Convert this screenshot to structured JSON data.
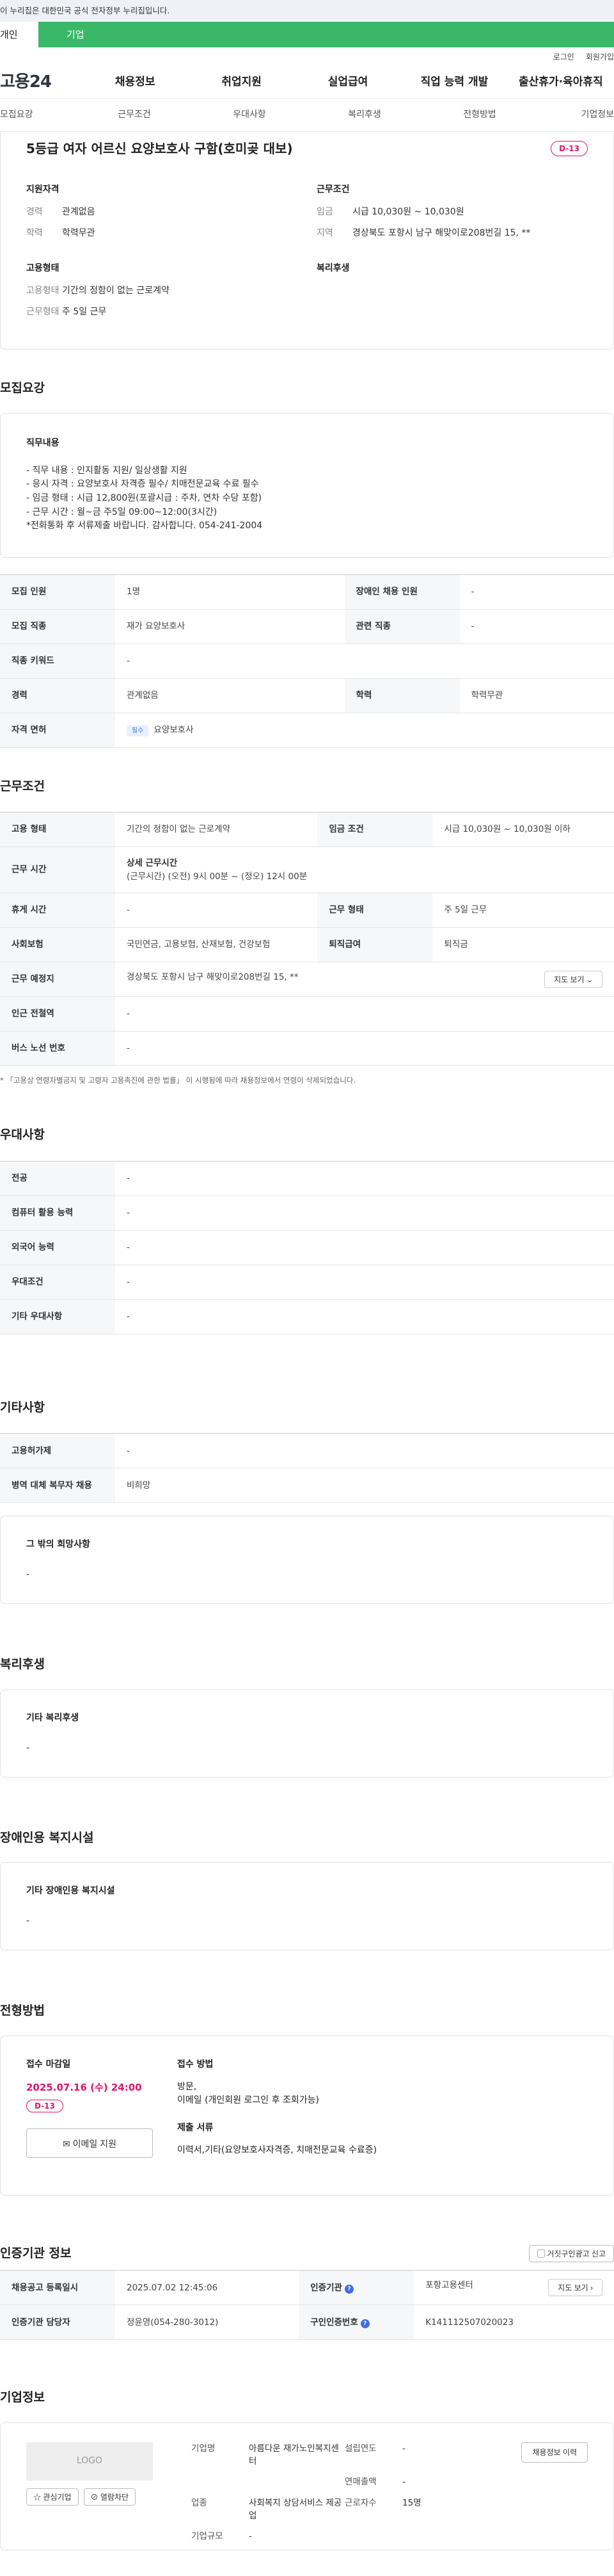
{
  "gov_bar": "이 누리집은 대한민국 공식 전자정부 누리집입니다.",
  "user_tabs": {
    "personal": "개인",
    "corporate": "기업"
  },
  "util": {
    "login": "로그인",
    "signup": "회원가입"
  },
  "gnb": {
    "logo": "고용24",
    "items": [
      "채용정보",
      "취업지원",
      "실업급여",
      "직업 능력 개발",
      "출산휴가·육아휴직"
    ]
  },
  "anchors": [
    "모집요강",
    "근무조건",
    "우대사항",
    "복리후생",
    "전형방법",
    "기업정보"
  ],
  "summary": {
    "title": "5등급 여자 어르신 요양보호사 구함(호미곶 대보)",
    "dday": "D-13",
    "qualification": {
      "heading": "지원자격",
      "career_k": "경력",
      "career_v": "관계없음",
      "edu_k": "학력",
      "edu_v": "학력무관"
    },
    "conditions": {
      "heading": "근무조건",
      "wage_k": "임금",
      "wage_v": "시급 10,030원 ~ 10,030원",
      "loc_k": "지역",
      "loc_v": "경상북도 포항시 남구 해맞이로208번길 15, **"
    },
    "employment": {
      "heading": "고용형태",
      "type_k": "고용형태",
      "type_v": "기간의 정함이 없는 근로계약",
      "hours_k": "근무형태",
      "hours_v": "주 5일 근무"
    },
    "welfare": {
      "heading": "복리후생"
    }
  },
  "recruit": {
    "heading": "모집요강",
    "desc_title": "직무내용",
    "desc_lines": [
      "- 직무 내용 : 인지활동 지원/ 일상생활 지원",
      "- 응시 자격 : 요양보호사 자격증 필수/ 치매전문교육 수료 필수",
      "- 임금 형태 : 시급 12,800원(포괄시급 : 주차, 연차 수당 포함)",
      "- 근무 시간 : 월~금  주5일  09:00~12:00(3시간)",
      "*전화통화 후 서류제출 바랍니다. 감사합니다. 054-241-2004"
    ],
    "rows": {
      "headcount_k": "모집 인원",
      "headcount_v": "1명",
      "disabled_k": "장애인 채용 인원",
      "disabled_v": "-",
      "job_k": "모집 직종",
      "job_v": "재가 요양보호사",
      "related_k": "관련 직종",
      "related_v": "-",
      "keyword_k": "직종 키워드",
      "keyword_v": "-",
      "career_k": "경력",
      "career_v": "관계없음",
      "edu_k": "학력",
      "edu_v": "학력무관",
      "license_k": "자격 면허",
      "license_badge": "필수",
      "license_v": "요양보호사"
    }
  },
  "work": {
    "heading": "근무조건",
    "type_k": "고용 형태",
    "type_v": "기간의 정함이 없는 근로계약",
    "wage_k": "임금 조건",
    "wage_v": "시급 10,030원 ~ 10,030원 이하",
    "time_k": "근무 시간",
    "time_title": "상세 근무시간",
    "time_v": "(근무시간) (오전) 9시 00분 ~ (정오) 12시 00분",
    "rest_k": "휴게 시간",
    "rest_v": "-",
    "form_k": "근무 형태",
    "form_v": "주 5일 근무",
    "insurance_k": "사회보험",
    "insurance_v": "국민연금, 고용보험, 산재보험, 건강보험",
    "retire_k": "퇴직급여",
    "retire_v": "퇴직금",
    "place_k": "근무 예정지",
    "place_v": "경상북도 포항시 남구 해맞이로208번길 15, **",
    "map": "지도 보기",
    "subway_k": "인근 전철역",
    "subway_v": "-",
    "bus_k": "버스 노선 번호",
    "bus_v": "-",
    "note": "* 「고용상 연령차별금지 및 고령자 고용촉진에 관한 법률」 이 시행됨에 따라 채용정보에서 연령이 삭제되었습니다."
  },
  "preference": {
    "heading": "우대사항",
    "major_k": "전공",
    "major_v": "-",
    "computer_k": "컴퓨터 활용 능력",
    "computer_v": "-",
    "lang_k": "외국어 능력",
    "lang_v": "-",
    "cond_k": "우대조건",
    "cond_v": "-",
    "etc_k": "기타 우대사항",
    "etc_v": "-"
  },
  "etc": {
    "heading": "기타사항",
    "insurance_k": "고용허가제",
    "insurance_v": "-",
    "military_k": "병역 대체 복무자 채용",
    "military_v": "비희망",
    "wish_title": "그 밖의 희망사항",
    "wish_v": "-"
  },
  "welfare": {
    "heading": "복리후생",
    "title": "기타 복리후생",
    "v": "-"
  },
  "facility": {
    "heading": "장애인용 복지시설",
    "title": "기타 장애인용 복지시설",
    "v": "-"
  },
  "selection": {
    "heading": "전형방법",
    "deadline_title": "접수 마감일",
    "deadline": "2025.07.16 (수) 24:00",
    "dday": "D-13",
    "email_btn": "이메일 지원",
    "method_title": "접수 방법",
    "method_v1": "방문,",
    "method_v2": "이메일 (개인회원 로그인 후 조회가능)",
    "docs_title": "제출 서류",
    "docs_v": "이력서,기타(요양보호사자격증, 치매전문교육 수료증)"
  },
  "agency": {
    "heading": "인증기관 정보",
    "report": "거짓구인광고 신고",
    "reg_k": "채용공고 등록일시",
    "reg_v": "2025.07.02 12:45:06",
    "org_k": "인증기관",
    "org_v": "포항고용센터",
    "map": "지도 보기",
    "manager_k": "인증기관 담당자",
    "manager_v": "정윤영(054-280-3012)",
    "id_k": "구인인증번호",
    "id_v": "K141112507020023"
  },
  "company": {
    "heading": "기업정보",
    "logo": "LOGO",
    "fav": "관심기업",
    "block": "열람차단",
    "history": "채용정보 이력",
    "name_k": "기업명",
    "name_v": "아름다운 재가노인복지센터",
    "found_k": "설립연도",
    "found_v": "-",
    "sales_k": "연매출액",
    "sales_v": "-",
    "biz_k": "업종",
    "biz_v": "사회복지 상담서비스 제공업",
    "emp_k": "근로자수",
    "emp_v": "15명",
    "size_k": "기업규모",
    "size_v": "-"
  }
}
